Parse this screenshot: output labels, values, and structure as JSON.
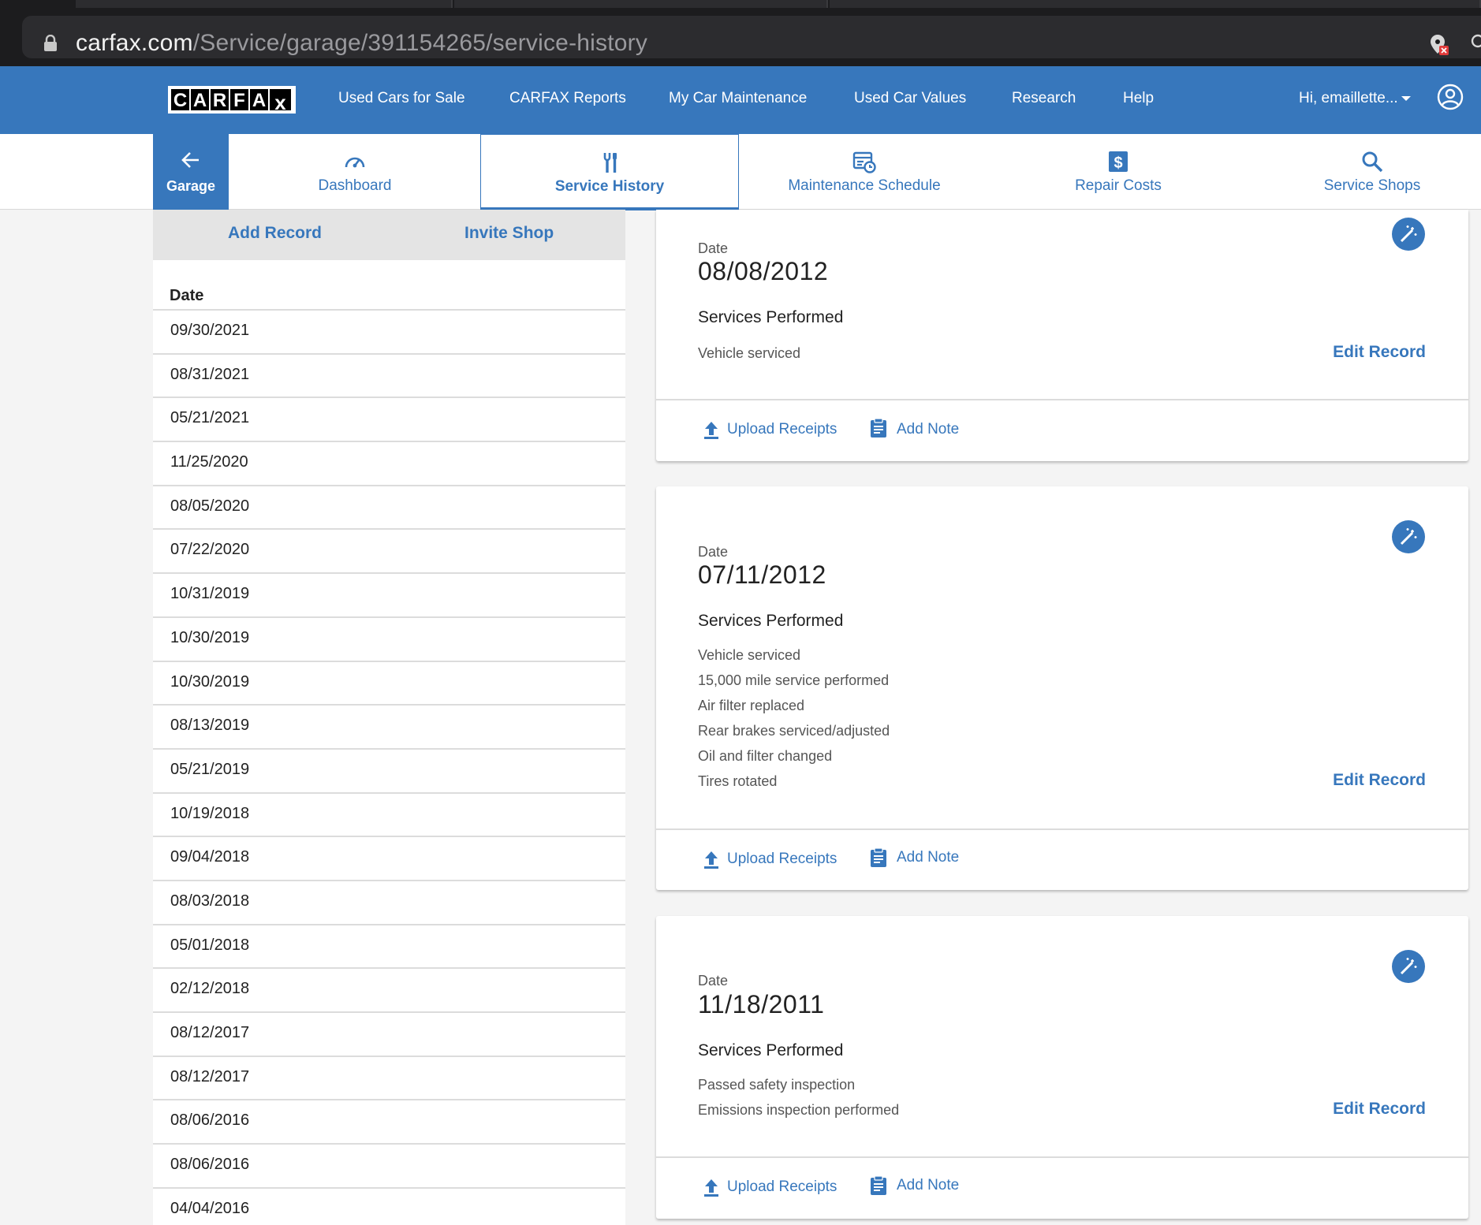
{
  "browser": {
    "url_host": "carfax.com",
    "url_path": "/Service/garage/391154265/service-history"
  },
  "header": {
    "logo_text": "CARFAX",
    "nav": [
      "Used Cars for Sale",
      "CARFAX Reports",
      "My Car Maintenance",
      "Used Car Values",
      "Research",
      "Help"
    ],
    "user_greeting": "Hi, emaillette..."
  },
  "subnav": {
    "garage_label": "Garage",
    "tabs": [
      {
        "label": "Dashboard",
        "icon": "speedometer-icon"
      },
      {
        "label": "Service History",
        "icon": "wrench-screwdriver-icon",
        "active": true
      },
      {
        "label": "Maintenance Schedule",
        "icon": "calendar-clock-icon"
      },
      {
        "label": "Repair Costs",
        "icon": "dollar-icon"
      },
      {
        "label": "Service Shops",
        "icon": "search-icon"
      }
    ]
  },
  "left_panel": {
    "add_record": "Add Record",
    "invite_shop": "Invite Shop",
    "column_header": "Date",
    "dates": [
      "09/30/2021",
      "08/31/2021",
      "05/21/2021",
      "11/25/2020",
      "08/05/2020",
      "07/22/2020",
      "10/31/2019",
      "10/30/2019",
      "10/30/2019",
      "08/13/2019",
      "05/21/2019",
      "10/19/2018",
      "09/04/2018",
      "08/03/2018",
      "05/01/2018",
      "02/12/2018",
      "08/12/2017",
      "08/12/2017",
      "08/06/2016",
      "08/06/2016",
      "04/04/2016"
    ]
  },
  "records": [
    {
      "date_label": "Date",
      "date": "08/08/2012",
      "services_title": "Services Performed",
      "services": [
        "Vehicle serviced"
      ],
      "edit_label": "Edit Record",
      "upload_label": "Upload Receipts",
      "note_label": "Add Note"
    },
    {
      "date_label": "Date",
      "date": "07/11/2012",
      "services_title": "Services Performed",
      "services": [
        "Vehicle serviced",
        "15,000 mile service performed",
        "Air filter replaced",
        "Rear brakes serviced/adjusted",
        "Oil and filter changed",
        "Tires rotated"
      ],
      "edit_label": "Edit Record",
      "upload_label": "Upload Receipts",
      "note_label": "Add Note"
    },
    {
      "date_label": "Date",
      "date": "11/18/2011",
      "services_title": "Services Performed",
      "services": [
        "Passed safety inspection",
        "Emissions inspection performed"
      ],
      "edit_label": "Edit Record",
      "upload_label": "Upload Receipts",
      "note_label": "Add Note"
    }
  ],
  "colors": {
    "brand_blue": "#3777bc",
    "page_bg": "#f4f4f4"
  }
}
